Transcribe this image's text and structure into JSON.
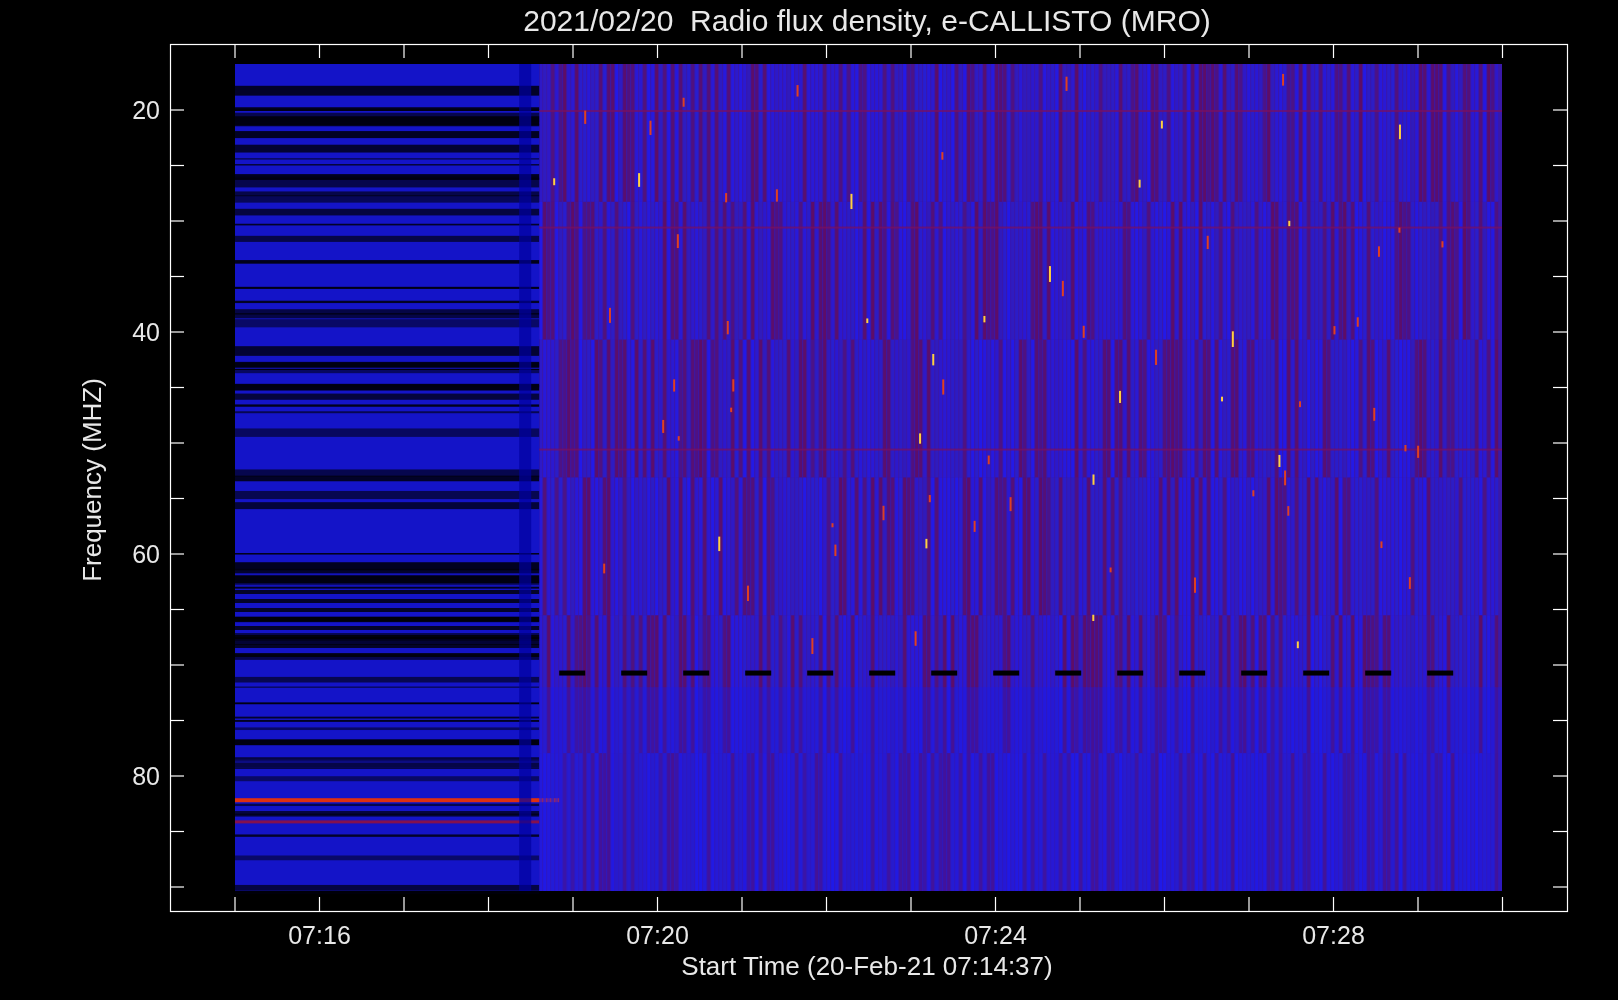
{
  "plot": {
    "title": "2021/02/20  Radio flux density, e-CALLISTO (MRO)",
    "ylabel": "Frequency (MHZ)",
    "xlabel": "Start Time (20-Feb-21 07:14:37)",
    "yticks": [
      "20",
      "40",
      "60",
      "80"
    ],
    "xticks": [
      "07:16",
      "07:20",
      "07:24",
      "07:28"
    ]
  }
}
